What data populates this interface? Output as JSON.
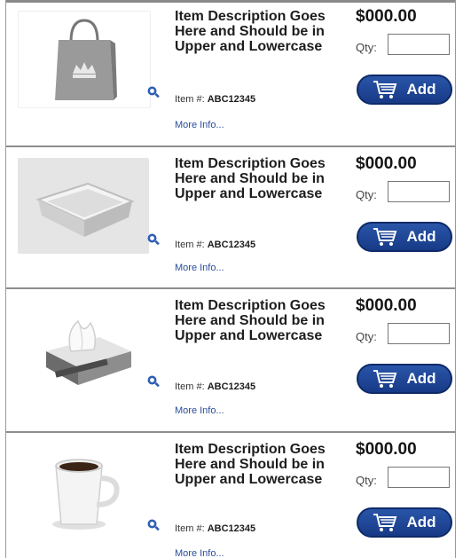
{
  "products": [
    {
      "image": "shopping-bag-icon",
      "description": "Item Description Goes Here and Should be in Upper and Lowercase",
      "item_prefix": "Item #: ",
      "item_number": "ABC12345",
      "more_info": "More Info...",
      "price": "$000.00",
      "qty_label": "Qty:",
      "add_label": "Add"
    },
    {
      "image": "foil-tray-icon",
      "description": "Item Description Goes Here and Should be in Upper and Lowercase",
      "item_prefix": "Item #: ",
      "item_number": "ABC12345",
      "more_info": "More Info...",
      "price": "$000.00",
      "qty_label": "Qty:",
      "add_label": "Add"
    },
    {
      "image": "tissue-box-icon",
      "description": "Item Description Goes Here and Should be in Upper and Lowercase",
      "item_prefix": "Item #: ",
      "item_number": "ABC12345",
      "more_info": "More Info...",
      "price": "$000.00",
      "qty_label": "Qty:",
      "add_label": "Add"
    },
    {
      "image": "coffee-mug-icon",
      "description": "Item Description Goes Here and Should be in Upper and Lowercase",
      "item_prefix": "Item #: ",
      "item_number": "ABC12345",
      "more_info": "More Info...",
      "price": "$000.00",
      "qty_label": "Qty:",
      "add_label": "Add"
    }
  ],
  "colors": {
    "button": "#1f4698",
    "link": "#2a4d9b",
    "divider": "#8e8e8e"
  }
}
